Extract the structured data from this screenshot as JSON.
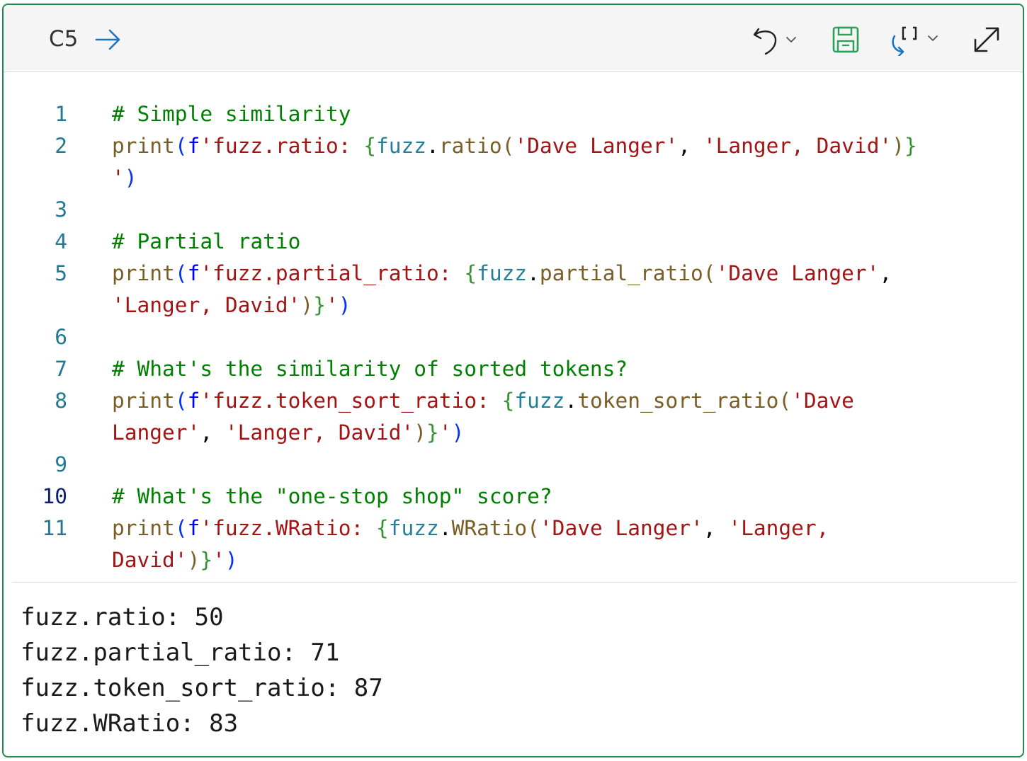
{
  "header": {
    "cell_ref": "C5",
    "icons": {
      "go_to": "arrow-right-icon",
      "undo": "undo-icon",
      "save": "save-icon",
      "run_mode": "refresh-bracket-icon",
      "expand": "expand-icon"
    },
    "colors": {
      "border": "#1f8a4c",
      "save_icon": "#2aa05a",
      "arrow_icon": "#1a73c7"
    }
  },
  "editor": {
    "lines": [
      {
        "n": "1",
        "segments": [
          {
            "t": "# Simple similarity",
            "c": "c"
          }
        ]
      },
      {
        "n": "2",
        "segments": [
          {
            "t": "print",
            "c": "f"
          },
          {
            "t": "(",
            "c": "p"
          },
          {
            "t": "f",
            "c": "k"
          },
          {
            "t": "'fuzz.ratio: ",
            "c": "s"
          },
          {
            "t": "{",
            "c": "b"
          },
          {
            "t": "fuzz",
            "c": "fv"
          },
          {
            "t": ".",
            "c": "x"
          },
          {
            "t": "ratio",
            "c": "f"
          },
          {
            "t": "(",
            "c": "f"
          },
          {
            "t": "'Dave Langer'",
            "c": "s"
          },
          {
            "t": ", ",
            "c": "x"
          },
          {
            "t": "'Langer, David'",
            "c": "s"
          },
          {
            "t": ")",
            "c": "f"
          },
          {
            "t": "}",
            "c": "b"
          }
        ]
      },
      {
        "n": "",
        "segments": [
          {
            "t": "'",
            "c": "s"
          },
          {
            "t": ")",
            "c": "p"
          }
        ]
      },
      {
        "n": "3",
        "segments": []
      },
      {
        "n": "4",
        "segments": [
          {
            "t": "# Partial ratio",
            "c": "c"
          }
        ]
      },
      {
        "n": "5",
        "segments": [
          {
            "t": "print",
            "c": "f"
          },
          {
            "t": "(",
            "c": "p"
          },
          {
            "t": "f",
            "c": "k"
          },
          {
            "t": "'fuzz.partial_ratio: ",
            "c": "s"
          },
          {
            "t": "{",
            "c": "b"
          },
          {
            "t": "fuzz",
            "c": "fv"
          },
          {
            "t": ".",
            "c": "x"
          },
          {
            "t": "partial_ratio",
            "c": "f"
          },
          {
            "t": "(",
            "c": "f"
          },
          {
            "t": "'Dave Langer'",
            "c": "s"
          },
          {
            "t": ",",
            "c": "x"
          }
        ]
      },
      {
        "n": "",
        "segments": [
          {
            "t": "'Langer, David'",
            "c": "s"
          },
          {
            "t": ")",
            "c": "f"
          },
          {
            "t": "}",
            "c": "b"
          },
          {
            "t": "'",
            "c": "s"
          },
          {
            "t": ")",
            "c": "p"
          }
        ]
      },
      {
        "n": "6",
        "segments": []
      },
      {
        "n": "7",
        "segments": [
          {
            "t": "# What's the similarity of sorted tokens?",
            "c": "c"
          }
        ]
      },
      {
        "n": "8",
        "segments": [
          {
            "t": "print",
            "c": "f"
          },
          {
            "t": "(",
            "c": "p"
          },
          {
            "t": "f",
            "c": "k"
          },
          {
            "t": "'fuzz.token_sort_ratio: ",
            "c": "s"
          },
          {
            "t": "{",
            "c": "b"
          },
          {
            "t": "fuzz",
            "c": "fv"
          },
          {
            "t": ".",
            "c": "x"
          },
          {
            "t": "token_sort_ratio",
            "c": "f"
          },
          {
            "t": "(",
            "c": "f"
          },
          {
            "t": "'Dave",
            "c": "s"
          }
        ]
      },
      {
        "n": "",
        "segments": [
          {
            "t": "Langer'",
            "c": "s"
          },
          {
            "t": ", ",
            "c": "x"
          },
          {
            "t": "'Langer, David'",
            "c": "s"
          },
          {
            "t": ")",
            "c": "f"
          },
          {
            "t": "}",
            "c": "b"
          },
          {
            "t": "'",
            "c": "s"
          },
          {
            "t": ")",
            "c": "p"
          }
        ]
      },
      {
        "n": "9",
        "segments": []
      },
      {
        "n": "10",
        "active": true,
        "segments": [
          {
            "t": "# What's the \"one-stop shop\" score?",
            "c": "c"
          }
        ]
      },
      {
        "n": "11",
        "segments": [
          {
            "t": "print",
            "c": "f"
          },
          {
            "t": "(",
            "c": "p"
          },
          {
            "t": "f",
            "c": "k"
          },
          {
            "t": "'fuzz.WRatio: ",
            "c": "s"
          },
          {
            "t": "{",
            "c": "b"
          },
          {
            "t": "fuzz",
            "c": "fv"
          },
          {
            "t": ".",
            "c": "x"
          },
          {
            "t": "WRatio",
            "c": "f"
          },
          {
            "t": "(",
            "c": "f"
          },
          {
            "t": "'Dave Langer'",
            "c": "s"
          },
          {
            "t": ", ",
            "c": "x"
          },
          {
            "t": "'Langer,",
            "c": "s"
          }
        ]
      },
      {
        "n": "",
        "segments": [
          {
            "t": "David'",
            "c": "s"
          },
          {
            "t": ")",
            "c": "f"
          },
          {
            "t": "}",
            "c": "b"
          },
          {
            "t": "'",
            "c": "s"
          },
          {
            "t": ")",
            "c": "p"
          }
        ]
      }
    ]
  },
  "output": {
    "lines": [
      "fuzz.ratio: 50",
      "fuzz.partial_ratio: 71",
      "fuzz.token_sort_ratio: 87",
      "fuzz.WRatio: 83"
    ]
  }
}
